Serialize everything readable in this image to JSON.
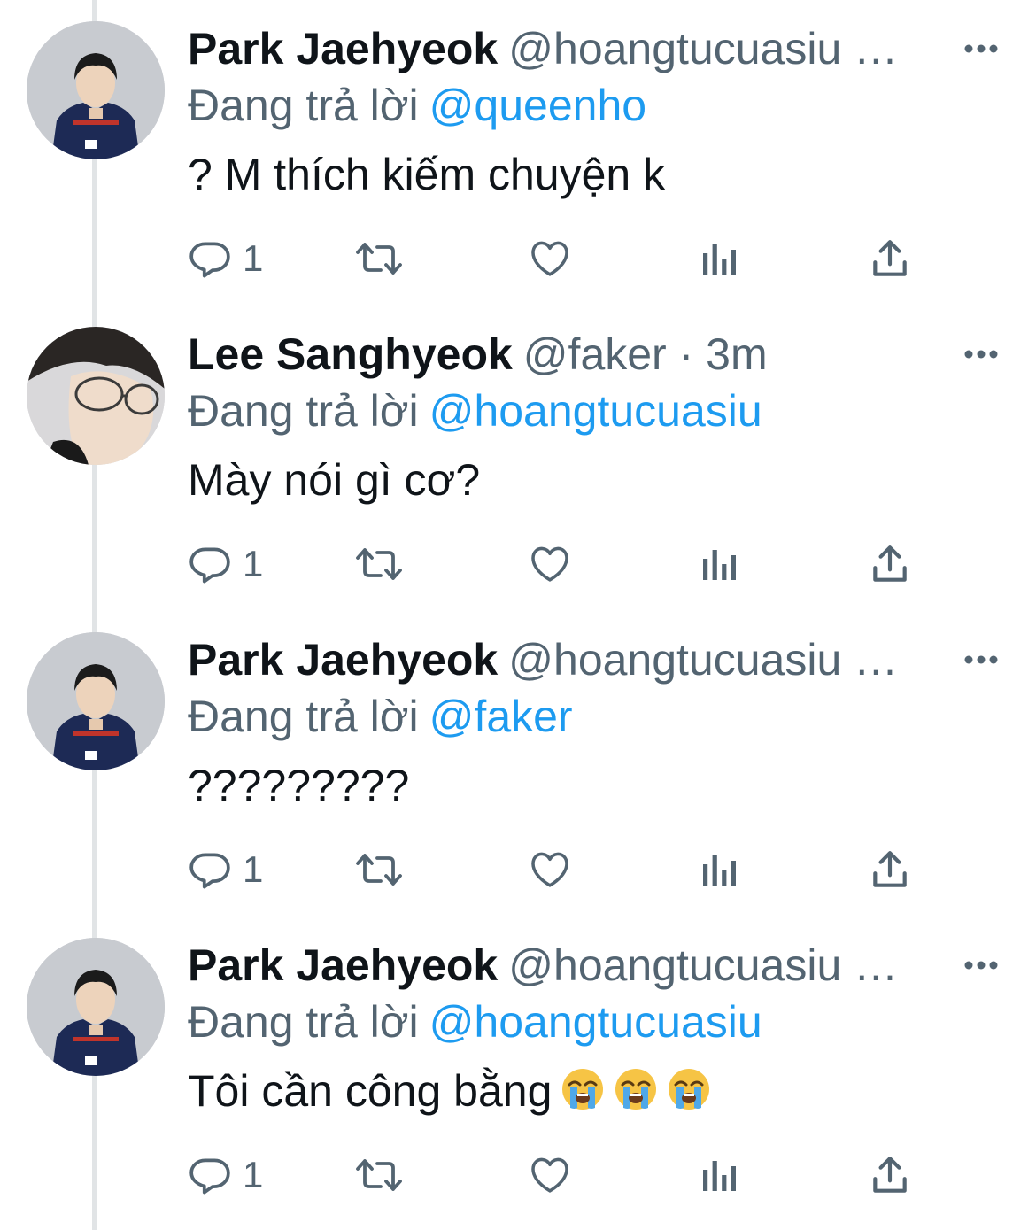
{
  "tweets": [
    {
      "name": "Park Jaehyeok",
      "handle": "@hoangtucuasiu …",
      "reply_prefix": "Đang trả lời",
      "reply_to": "@queenho",
      "text": "? M thích kiếm chuyện k",
      "emojis": [],
      "reply_count": "1",
      "avatar": "park-jaehyeok-avatar"
    },
    {
      "name": "Lee Sanghyeok",
      "handle": "@faker · 3m",
      "reply_prefix": "Đang trả lời",
      "reply_to": "@hoangtucuasiu",
      "text": "Mày nói gì cơ?",
      "emojis": [],
      "reply_count": "1",
      "avatar": "lee-sanghyeok-avatar"
    },
    {
      "name": "Park Jaehyeok",
      "handle": "@hoangtucuasiu …",
      "reply_prefix": "Đang trả lời",
      "reply_to": "@faker",
      "text": "?????????",
      "emojis": [],
      "reply_count": "1",
      "avatar": "park-jaehyeok-avatar"
    },
    {
      "name": "Park Jaehyeok",
      "handle": "@hoangtucuasiu …",
      "reply_prefix": "Đang trả lời",
      "reply_to": "@hoangtucuasiu",
      "text": "Tôi cần công bằng",
      "emojis": [
        "loudly-crying-face-emoji",
        "loudly-crying-face-emoji",
        "loudly-crying-face-emoji"
      ],
      "reply_count": "1",
      "avatar": "park-jaehyeok-avatar"
    }
  ],
  "icons": {
    "more": "more-horizontal-icon",
    "reply": "reply-icon",
    "retweet": "retweet-icon",
    "like": "like-icon",
    "views": "analytics-icon",
    "share": "share-icon"
  },
  "colors": {
    "text": "#0f1419",
    "secondary": "#536471",
    "link": "#1d9bf0",
    "thread_line": "#e1e4e6"
  }
}
